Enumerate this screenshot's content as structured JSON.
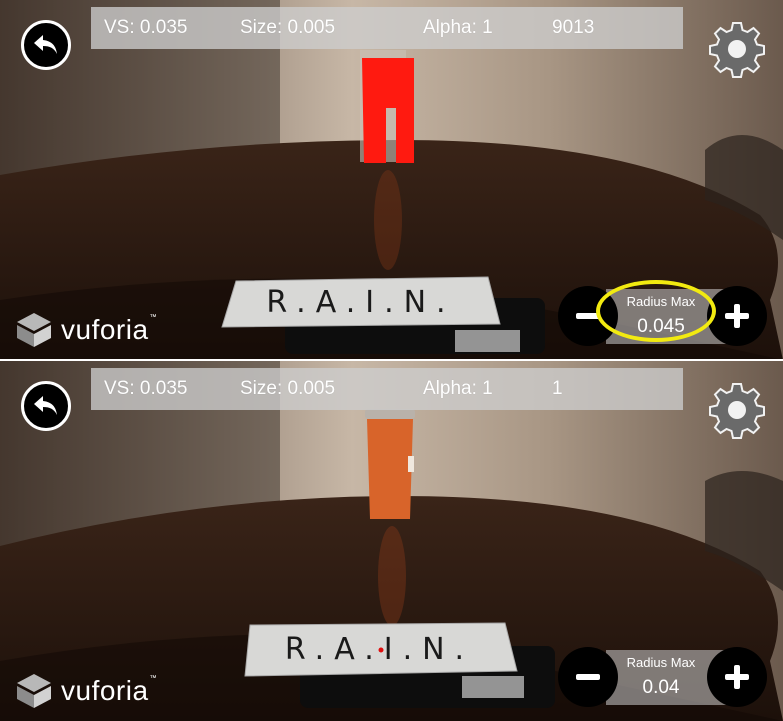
{
  "panels": [
    {
      "hud": {
        "vs": "VS: 0.035",
        "size": "Size: 0.005",
        "alpha": "Alpha: 1",
        "count": "9013"
      },
      "stepper": {
        "label": "Radius Max",
        "value": "0.045",
        "highlighted": true
      },
      "brand": {
        "name": "vuforia",
        "tm": "™"
      },
      "marker_text": "R.A.I.N.",
      "object_color": "#ff1a10"
    },
    {
      "hud": {
        "vs": "VS: 0.035",
        "size": "Size: 0.005",
        "alpha": "Alpha: 1",
        "count": "1"
      },
      "stepper": {
        "label": "Radius Max",
        "value": "0.04",
        "highlighted": false
      },
      "brand": {
        "name": "vuforia",
        "tm": "™"
      },
      "marker_text": "R.A.I.N.",
      "object_color": "#d8642a"
    }
  ],
  "icons": {
    "back": "back-arrow-icon",
    "settings": "gear-icon",
    "minus": "minus-icon",
    "plus": "plus-icon",
    "logo": "vuforia-logo-icon"
  },
  "colors": {
    "highlight": "#f2ea10",
    "hud_bg": "#cdcdcd",
    "button_bg": "#000000"
  }
}
